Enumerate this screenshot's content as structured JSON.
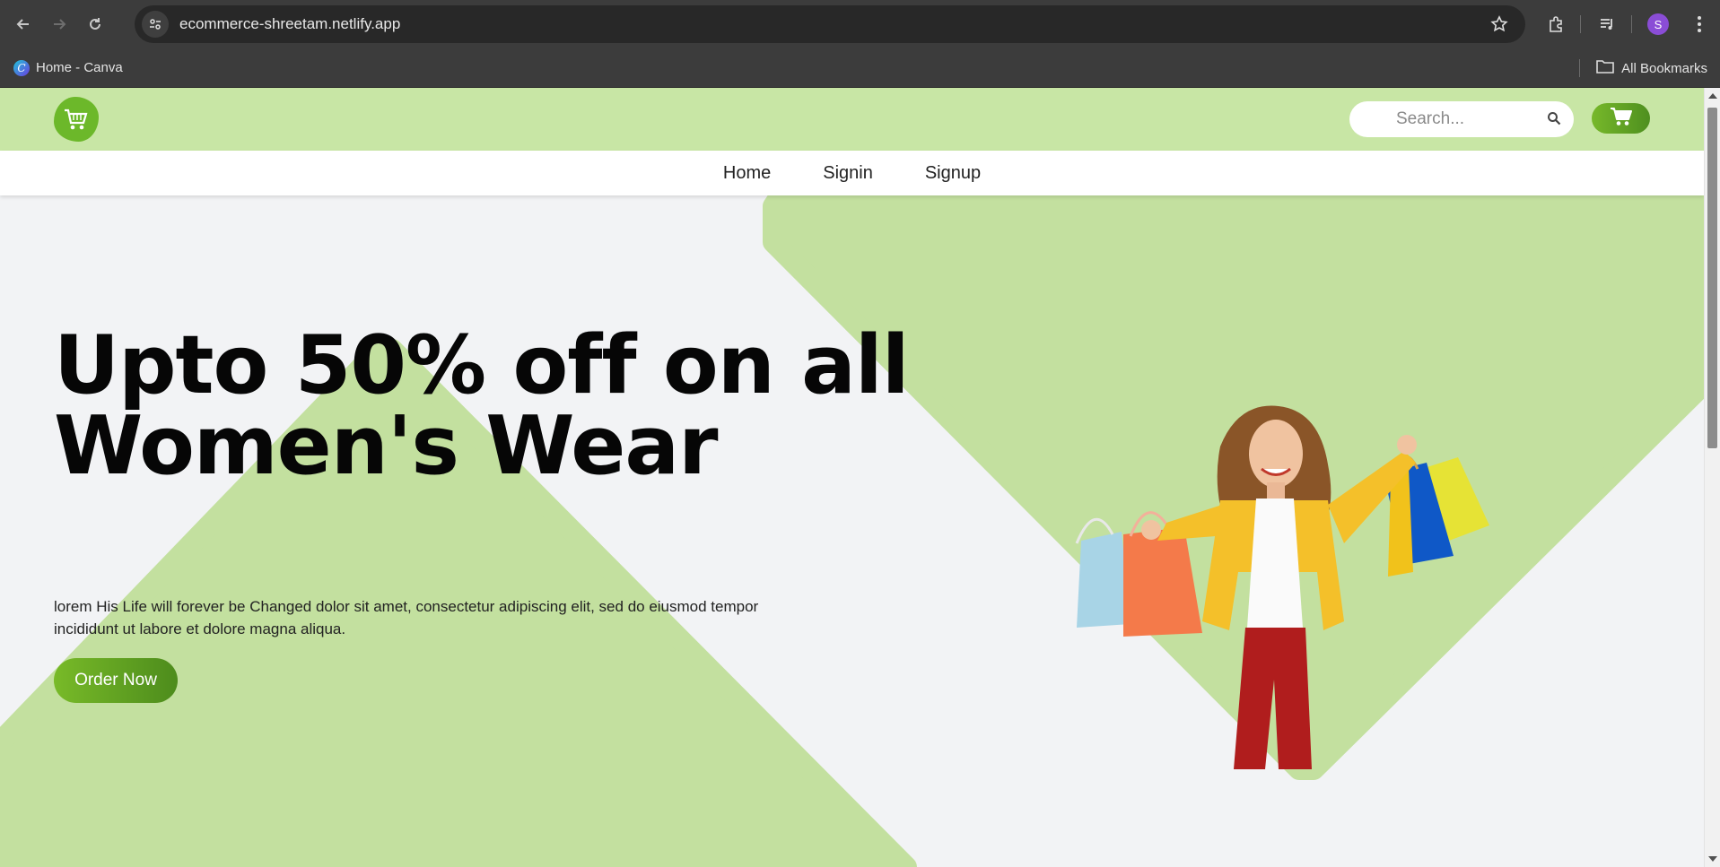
{
  "browser": {
    "url": "ecommerce-shreetam.netlify.app",
    "profile_initial": "S",
    "bookmarks": [
      {
        "label": "Home - Canva"
      }
    ],
    "all_bookmarks_label": "All Bookmarks"
  },
  "site": {
    "search": {
      "placeholder": "Search..."
    },
    "nav": {
      "home": "Home",
      "signin": "Signin",
      "signup": "Signup"
    },
    "hero": {
      "title_line1": "Upto 50% off on all",
      "title_line2": "Women's Wear",
      "description": "lorem His Life will forever be Changed dolor sit amet, consectetur adipiscing elit, sed do eiusmod tempor incididunt ut labore et dolore magna aliqua.",
      "cta_label": "Order Now"
    }
  },
  "colors": {
    "header_bg": "#c8e6a5",
    "accent_green": "#6cb82a",
    "shape_green": "#c3e09f",
    "page_bg": "#f2f3f5"
  },
  "icons": {
    "logo": "shopping-cart-blob-icon",
    "search": "search-icon",
    "cart": "cart-icon"
  }
}
